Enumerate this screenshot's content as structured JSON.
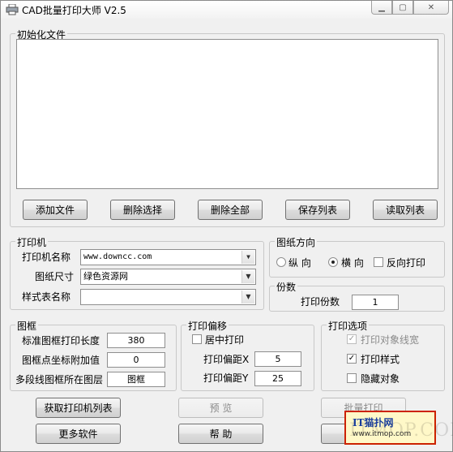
{
  "window": {
    "title": "CAD批量打印大师 V2.5"
  },
  "files": {
    "group_title": "初始化文件",
    "buttons": {
      "add": "添加文件",
      "delete_selected": "删除选择",
      "delete_all": "删除全部",
      "save_list": "保存列表",
      "read_list": "读取列表"
    }
  },
  "printer": {
    "group_title": "打印机",
    "name_label": "打印机名称",
    "name_value": "www.downcc.com",
    "paper_label": "图纸尺寸",
    "paper_value": "绿色资源网",
    "style_label": "样式表名称",
    "style_value": ""
  },
  "orientation": {
    "group_title": "图纸方向",
    "portrait": "纵 向",
    "landscape": "横 向",
    "landscape_selected": true,
    "reverse": "反向打印",
    "reverse_checked": false
  },
  "copies": {
    "group_title": "份数",
    "label": "打印份数",
    "value": "1"
  },
  "frame": {
    "group_title": "图框",
    "std_label": "标准图框打印长度",
    "std_value": "380",
    "coord_label": "图框点坐标附加值",
    "coord_value": "0",
    "layer_label": "多段线图框所在图层",
    "layer_value": "图框"
  },
  "offset": {
    "group_title": "打印偏移",
    "center_label": "居中打印",
    "center_checked": false,
    "x_label": "打印偏距X",
    "x_value": "5",
    "y_label": "打印偏距Y",
    "y_value": "25"
  },
  "options": {
    "group_title": "打印选项",
    "lineweight_label": "打印对象线宽",
    "lineweight_checked": true,
    "styles_label": "打印样式",
    "styles_checked": true,
    "hide_label": "隐藏对象",
    "hide_checked": false
  },
  "actions": {
    "get_printers": "获取打印机列表",
    "preview": "预 览",
    "batch_print": "批量打印",
    "more_software": "更多软件",
    "help": "帮 助"
  },
  "watermark": {
    "title": "IT猫扑网",
    "url": "www.itmop.com",
    "big": "ITMOP.COM"
  }
}
